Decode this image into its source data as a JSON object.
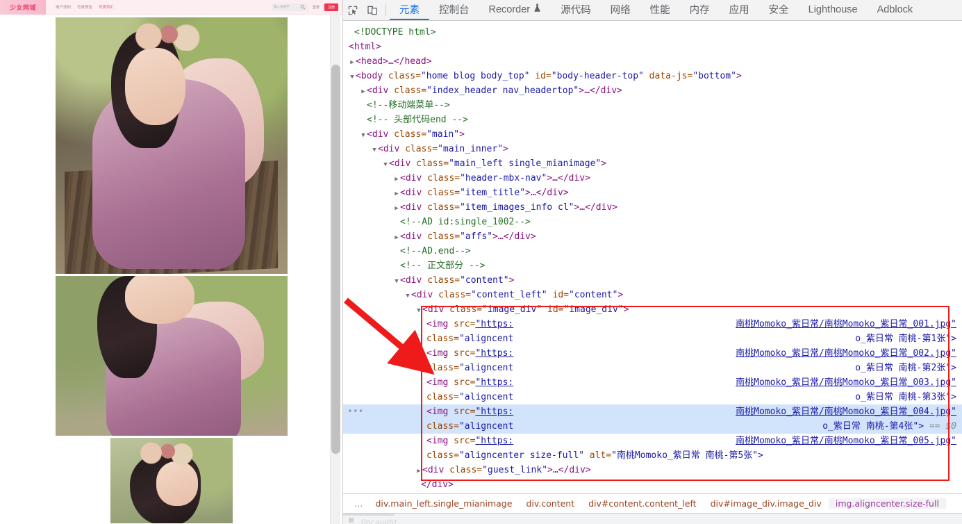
{
  "website": {
    "logo_text": "少女网域",
    "nav": [
      {
        "label": "用户须知",
        "hot": false
      },
      {
        "label": "写真预告",
        "hot": false
      },
      {
        "label": "写真列汇",
        "hot": true
      }
    ],
    "search_placeholder": "输入关键字",
    "search_icon": "search-icon",
    "login_label": "登录",
    "register_label": "注册"
  },
  "devtools": {
    "icons": {
      "inspect": "inspect-element-icon",
      "device": "device-toolbar-icon"
    },
    "tabs": [
      {
        "label": "元素",
        "active": true
      },
      {
        "label": "控制台",
        "active": false
      },
      {
        "label": "Recorder",
        "active": false,
        "badge": "flask-icon"
      },
      {
        "label": "源代码",
        "active": false
      },
      {
        "label": "网络",
        "active": false
      },
      {
        "label": "性能",
        "active": false
      },
      {
        "label": "内存",
        "active": false
      },
      {
        "label": "应用",
        "active": false
      },
      {
        "label": "安全",
        "active": false
      },
      {
        "label": "Lighthouse",
        "active": false
      },
      {
        "label": "Adblock",
        "active": false
      }
    ],
    "dom": {
      "l01": "<!DOCTYPE html>",
      "l02": "<html>",
      "l03": "<head>…</head>",
      "l04_tag": "<body ",
      "l04_attr1": "class=",
      "l04_val1": "\"home blog body_top\"",
      "l04_attr2": " id=",
      "l04_val2": "\"body-header-top\"",
      "l04_attr3": " data-js=",
      "l04_val3": "\"bottom\"",
      "l04_end": ">",
      "l05_tag": "<div ",
      "l05_attr": "class=",
      "l05_val": "\"index_header nav_headertop\"",
      "l05_end": ">…</div>",
      "l06": "<!--移动端菜单-->",
      "l07": "<!-- 头部代码end -->",
      "l08_val": "\"main\"",
      "l09_val": "\"main_inner\"",
      "l10_val": "\"main_left single_mianimage\"",
      "l11_val": "\"header-mbx-nav\"",
      "l12_val": "\"item_title\"",
      "l13_val": "\"item_images_info cl\"",
      "l14": "<!--AD id:single_1002-->",
      "l15_val": "\"affs\"",
      "l16": "<!--AD.end-->",
      "l17": "<!-- 正文部分 -->",
      "l18_val": "\"content\"",
      "l19_attr": "class=",
      "l19_val": "\"content_left\"",
      "l19_attr2": " id=",
      "l19_val2": "\"content\"",
      "l20_attr": "class=",
      "l20_val": "\"image_div\"",
      "l20_attr2": " id=",
      "l20_val2": "\"image_div\"",
      "guest_link_val": "\"guest_link\"",
      "guest_link_end": ">…</div>",
      "close_div": "</div>"
    },
    "images": [
      {
        "img_open": "<img ",
        "src_attr": "src=",
        "src_proto": "\"https:",
        "href_text": "南桃Momoko_紫日常/南桃Momoko_紫日常_001.jpg\"",
        "class_attr": "class=",
        "class_val": "\"aligncent",
        "alt_tail": "o_紫日常 南桃-第1张\">",
        "selected": false
      },
      {
        "img_open": "<img ",
        "src_attr": "src=",
        "src_proto": "\"https:",
        "href_text": "南桃Momoko_紫日常/南桃Momoko_紫日常_002.jpg\"",
        "class_attr": "class=",
        "class_val": "\"aligncent",
        "alt_tail": "o_紫日常 南桃-第2张\">",
        "selected": false
      },
      {
        "img_open": "<img ",
        "src_attr": "src=",
        "src_proto": "\"https:",
        "href_text": "南桃Momoko_紫日常/南桃Momoko_紫日常_003.jpg\"",
        "class_attr": "class=",
        "class_val": "\"aligncent",
        "alt_tail": "o_紫日常 南桃-第3张\">",
        "selected": false
      },
      {
        "img_open": "<img ",
        "src_attr": "src=",
        "src_proto": "\"https:",
        "href_text": "南桃Momoko_紫日常/南桃Momoko_紫日常_004.jpg\"",
        "class_attr": "class=",
        "class_val": "\"aligncent",
        "alt_tail": "o_紫日常 南桃-第4张\">",
        "selected_marker": "== $0",
        "selected": true
      },
      {
        "img_open": "<img ",
        "src_attr": "src=",
        "src_proto": "\"https:",
        "href_text": "南桃Momoko_紫日常/南桃Momoko_紫日常_005.jpg\"",
        "class_attr": "class=",
        "class_val": "\"aligncenter size-full\"",
        "alt_attr": " alt=",
        "alt_val": "\"南桃Momoko_紫日常 南桃-第5张\">",
        "selected": false
      }
    ],
    "breadcrumb": {
      "ellipsis": "…",
      "items": [
        {
          "text": "div.main_left.single_mianimage",
          "active": false
        },
        {
          "text": "div.content",
          "active": false
        },
        {
          "text": "div#content.content_left",
          "active": false
        },
        {
          "text": "div#image_div.image_div",
          "active": false
        },
        {
          "text": "img.aligncenter.size-full",
          "active": true
        }
      ]
    },
    "colors": {
      "accent": "#1a73e8",
      "highlight_row": "#d2e3fc",
      "annotation_red": "#ef1b1b",
      "tag": "#881280",
      "attr": "#994500",
      "value": "#1a1aa6",
      "comment": "#236e25"
    }
  }
}
